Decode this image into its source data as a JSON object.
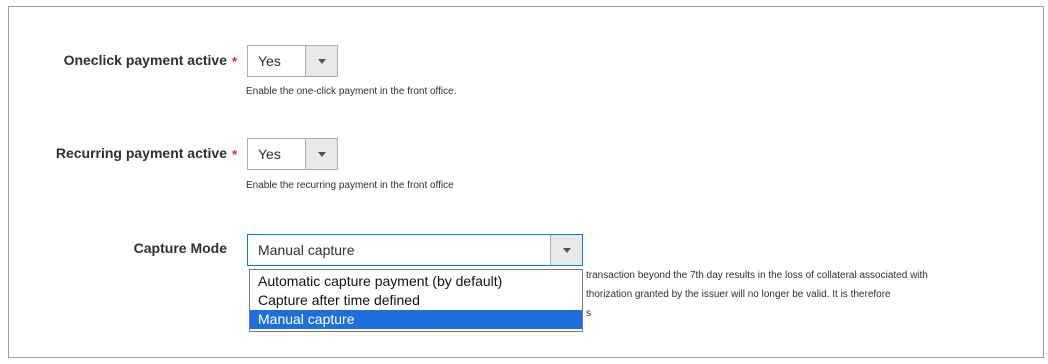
{
  "fields": {
    "oneclick": {
      "label": "Oneclick payment active",
      "required_mark": "*",
      "value": "Yes",
      "note": "Enable the one-click payment in the front office."
    },
    "recurring": {
      "label": "Recurring payment active",
      "required_mark": "*",
      "value": "Yes",
      "note": "Enable the recurring payment in the front office"
    },
    "capture": {
      "label": "Capture Mode",
      "value": "Manual capture",
      "options": [
        "Automatic capture payment (by default)",
        "Capture after time defined",
        "Manual capture"
      ],
      "selected_index": 2,
      "note_lines": [
        "transaction beyond the 7th day results in the loss of collateral associated with",
        "thorization granted by the issuer will no longer be valid. It is therefore",
        "s"
      ]
    }
  },
  "colors": {
    "required": "#e22626",
    "focus_border": "#007bdb",
    "selected_option": "#1e6fd9"
  },
  "icons": {
    "dropdown": "chevron-down-icon"
  }
}
